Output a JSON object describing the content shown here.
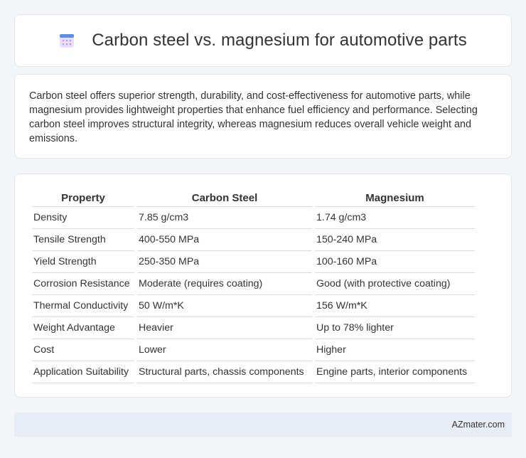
{
  "header": {
    "title": "Carbon steel vs. magnesium for automotive parts",
    "icon": "calendar-icon"
  },
  "summary": "Carbon steel offers superior strength, durability, and cost-effectiveness for automotive parts, while magnesium provides lightweight properties that enhance fuel efficiency and performance. Selecting carbon steel improves structural integrity, whereas magnesium reduces overall vehicle weight and emissions.",
  "table": {
    "headers": [
      "Property",
      "Carbon Steel",
      "Magnesium"
    ],
    "rows": [
      [
        "Density",
        "7.85 g/cm3",
        "1.74 g/cm3"
      ],
      [
        "Tensile Strength",
        "400-550 MPa",
        "150-240 MPa"
      ],
      [
        "Yield Strength",
        "250-350 MPa",
        "100-160 MPa"
      ],
      [
        "Corrosion Resistance",
        "Moderate (requires coating)",
        "Good (with protective coating)"
      ],
      [
        "Thermal Conductivity",
        "50 W/m*K",
        "156 W/m*K"
      ],
      [
        "Weight Advantage",
        "Heavier",
        "Up to 78% lighter"
      ],
      [
        "Cost",
        "Lower",
        "Higher"
      ],
      [
        "Application Suitability",
        "Structural parts, chassis components",
        "Engine parts, interior components"
      ]
    ]
  },
  "footer": {
    "text": "AZmater.com"
  },
  "colors": {
    "background": "#f3f5f8",
    "card": "#ffffff",
    "footer_bg": "#e7ecf5",
    "icon_top": "#5b8def",
    "icon_body": "#e9defb"
  }
}
